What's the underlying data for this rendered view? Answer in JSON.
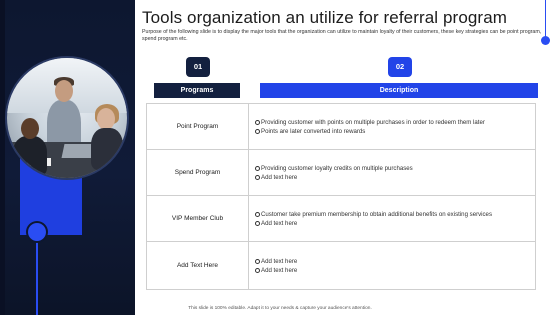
{
  "title": "Tools organization an utilize for referral program",
  "subtitle": "Purpose of the following slide is to display the major tools that the organization can utilize to maintain loyalty of their customers, these key strategies can be point program, spend program etc.",
  "badges": [
    "01",
    "02"
  ],
  "headers": {
    "programs": "Programs",
    "description": "Description"
  },
  "rows": [
    {
      "program": "Point Program",
      "bullets": [
        "Providing customer with points on multiple purchases in order to redeem them later",
        "Points are later converted into rewards"
      ]
    },
    {
      "program": "Spend Program",
      "bullets": [
        "Providing customer loyalty  credits on multiple purchases",
        "Add text here"
      ]
    },
    {
      "program": "VIP Member Club",
      "bullets": [
        "Customer take premium membership to obtain additional benefits on existing services",
        "Add text here"
      ]
    },
    {
      "program": "Add Text Here",
      "bullets": [
        "Add text here",
        "Add text here"
      ]
    }
  ],
  "footer": "This slide is 100% editable. Adapt it to your needs & capture your audience's attention.",
  "colors": {
    "navy": "#13203f",
    "blue": "#2244e8",
    "panel": "#0d1730"
  }
}
